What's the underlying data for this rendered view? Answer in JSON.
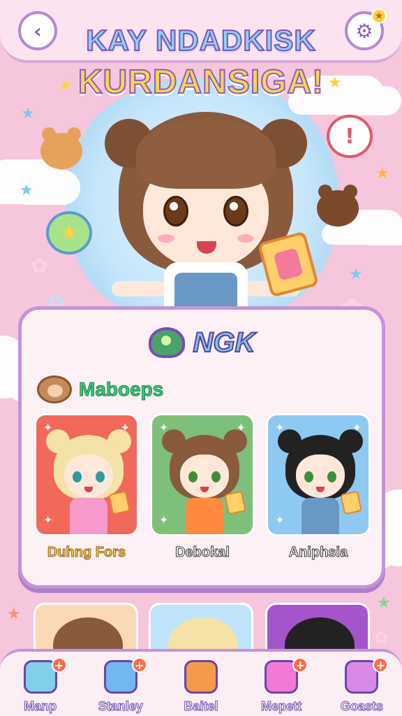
{
  "header": {
    "title_line1": "KAY NDADKISK",
    "title_line2": "KURDANSIGA!",
    "back_icon": "chevron-left-icon",
    "settings_icon": "gear-icon",
    "settings_badge": "★"
  },
  "hero": {
    "alert_bubble": "!",
    "chat_bubble": "★"
  },
  "panel": {
    "title": "NGK",
    "subtitle": "Maboeps",
    "characters": [
      {
        "name": "Duhng Fors",
        "hair": "#f4e2a6",
        "bg": "#f2685b",
        "outfit": "#f59acb",
        "eyes": "#2f9aa0",
        "label_color": "#ffd23f",
        "label_stroke": "#8a5a1f"
      },
      {
        "name": "Debokal",
        "hair": "#8a5a3c",
        "bg": "#7ec07a",
        "outfit": "#ff8a3d",
        "eyes": "#3d8f3a",
        "label_color": "#ffffff",
        "label_stroke": "#333333"
      },
      {
        "name": "Aniphsia",
        "hair": "#222222",
        "bg": "#8ec9f2",
        "outfit": "#6a98c4",
        "eyes": "#3d8f3a",
        "label_color": "#ffffff",
        "label_stroke": "#333333"
      }
    ]
  },
  "nav": {
    "items": [
      {
        "label": "Manp",
        "icon": "house-icon",
        "color": "#7fd0e8",
        "has_plus": true
      },
      {
        "label": "Stanley",
        "icon": "monster-icon",
        "color": "#6fb8f0",
        "has_plus": true
      },
      {
        "label": "Baitel",
        "icon": "fruit-icon",
        "color": "#f59a4a",
        "has_plus": false
      },
      {
        "label": "Mepett",
        "icon": "card-icon",
        "color": "#f27ad6",
        "has_plus": true
      },
      {
        "label": "Goasts",
        "icon": "book-icon",
        "color": "#d889e6",
        "has_plus": true
      }
    ]
  }
}
